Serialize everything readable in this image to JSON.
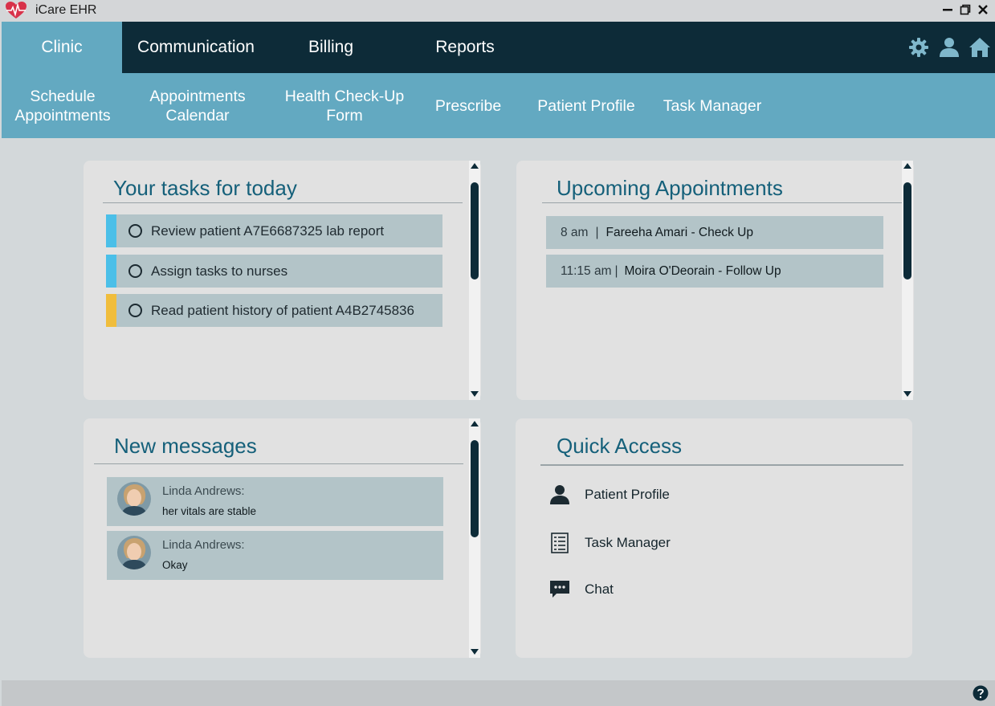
{
  "window": {
    "title": "iCare EHR",
    "logo_icon": "heart-pulse-icon",
    "controls": [
      "minimize-icon",
      "maximize-icon",
      "close-icon"
    ]
  },
  "main_nav": {
    "tabs": [
      {
        "label": "Clinic",
        "active": true
      },
      {
        "label": "Communication",
        "active": false
      },
      {
        "label": "Billing",
        "active": false
      },
      {
        "label": "Reports",
        "active": false
      }
    ],
    "icons": [
      "gear-icon",
      "user-icon",
      "home-icon"
    ]
  },
  "sub_nav": {
    "items": [
      {
        "line1": "Schedule",
        "line2": "Appointments"
      },
      {
        "line1": "Appointments",
        "line2": "Calendar"
      },
      {
        "line1": "Health Check-Up",
        "line2": "Form"
      },
      {
        "line1": "Prescribe",
        "line2": ""
      },
      {
        "line1": "Patient Profile",
        "line2": ""
      },
      {
        "line1": "Task Manager",
        "line2": ""
      }
    ]
  },
  "tasks": {
    "title": "Your tasks for today",
    "items": [
      {
        "text": "Review patient A7E6687325 lab report",
        "color": "#4bbfe8"
      },
      {
        "text": "Assign tasks to nurses",
        "color": "#4bbfe8"
      },
      {
        "text": "Read patient history of patient A4B2745836",
        "color": "#f0bd3c"
      }
    ]
  },
  "appointments": {
    "title": "Upcoming Appointments",
    "items": [
      {
        "time": "8 am",
        "sep": "|",
        "name": "Fareeha Amari - Check Up"
      },
      {
        "time": "11:15 am",
        "sep": "|",
        "name": "Moira O'Deorain - Follow Up"
      }
    ]
  },
  "messages": {
    "title": "New messages",
    "items": [
      {
        "sender": "Linda Andrews:",
        "text": "her vitals are stable"
      },
      {
        "sender": "Linda Andrews:",
        "text": "Okay"
      }
    ]
  },
  "quick_access": {
    "title": "Quick Access",
    "items": [
      {
        "label": "Patient Profile",
        "icon": "user-icon"
      },
      {
        "label": "Task Manager",
        "icon": "list-icon"
      },
      {
        "label": "Chat",
        "icon": "chat-icon"
      }
    ]
  },
  "colors": {
    "nav_dark": "#0d2b38",
    "nav_accent": "#63a9c1",
    "title_text": "#15607a",
    "item_bg": "#b3c4c8"
  }
}
